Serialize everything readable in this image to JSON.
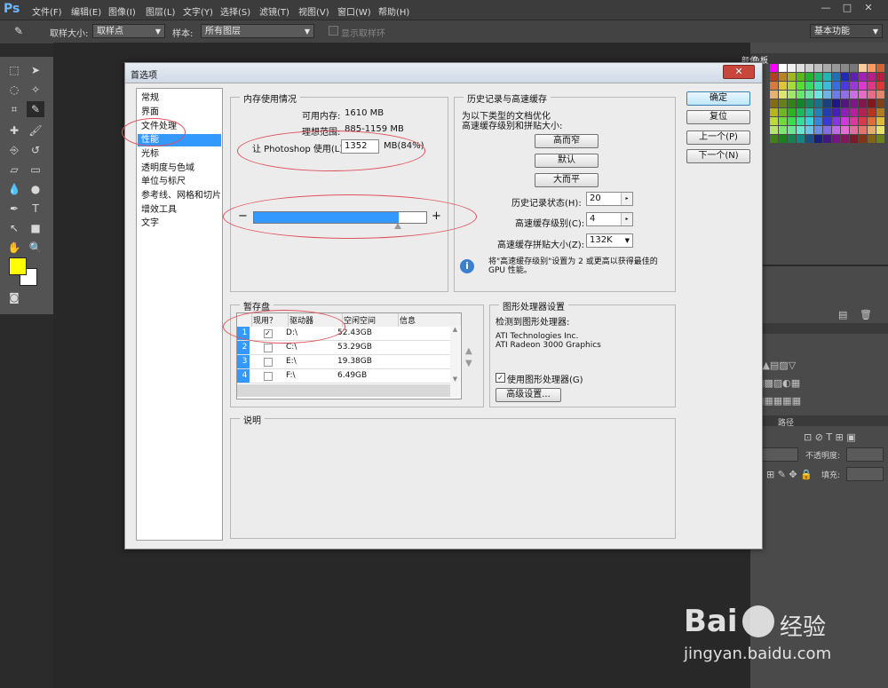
{
  "app": {
    "logo": "Ps",
    "menu": [
      "文件(F)",
      "编辑(E)",
      "图像(I)",
      "图层(L)",
      "文字(Y)",
      "选择(S)",
      "滤镜(T)",
      "视图(V)",
      "窗口(W)",
      "帮助(H)"
    ],
    "window_controls": [
      "—",
      "□",
      "✕"
    ]
  },
  "options": {
    "sample_size_label": "取样大小:",
    "sample_size_value": "取样点",
    "sample_label": "样本:",
    "sample_value": "所有图层",
    "show_ring_label": "显示取样环",
    "workspace_value": "基本功能"
  },
  "panels": {
    "tab_swatches_inactive": "颜色",
    "tab_swatches": "色板",
    "layers_tab_b": "路径",
    "opacity_label": "不透明度:",
    "fill_label": "填充:"
  },
  "dialog": {
    "title": "首选项",
    "close": "✕",
    "categories": [
      "常规",
      "界面",
      "文件处理",
      "性能",
      "光标",
      "透明度与色域",
      "单位与标尺",
      "参考线、网格和切片",
      "增效工具",
      "文字"
    ],
    "selected_category_index": 3,
    "buttons": {
      "ok": "确定",
      "reset": "复位",
      "prev": "上一个(P)",
      "next": "下一个(N)"
    },
    "memory": {
      "title": "内存使用情况",
      "available_label": "可用内存:",
      "available_value": "1610 MB",
      "ideal_label": "理想范围:",
      "ideal_value": "885-1159 MB",
      "use_label": "让 Photoshop 使用(L):",
      "use_value": "1352",
      "use_unit": "MB(84%)",
      "slider_fraction": 0.84,
      "minus": "−",
      "plus": "+"
    },
    "history": {
      "title": "历史记录与高速缓存",
      "desc1": "为以下类型的文档优化",
      "desc2": "高速缓存级别和拼贴大小:",
      "btn_tall_thin": "高而窄",
      "btn_default": "默认",
      "btn_big_flat": "大而平",
      "history_states_label": "历史记录状态(H):",
      "history_states_value": "20",
      "cache_levels_label": "高速缓存级别(C):",
      "cache_levels_value": "4",
      "tile_size_label": "高速缓存拼贴大小(Z):",
      "tile_size_value": "132K",
      "info_text1": "将\"高速缓存级别\"设置为 2 或更高以获得最佳的",
      "info_text2": "GPU 性能。"
    },
    "scratch": {
      "title": "暂存盘",
      "headers": [
        "现用？",
        "驱动器",
        "空闲空间",
        "信息"
      ],
      "rows": [
        {
          "n": "1",
          "active": true,
          "drive": "D:\\",
          "free": "52.43GB",
          "info": ""
        },
        {
          "n": "2",
          "active": false,
          "drive": "C:\\",
          "free": "53.29GB",
          "info": ""
        },
        {
          "n": "3",
          "active": false,
          "drive": "E:\\",
          "free": "19.38GB",
          "info": ""
        },
        {
          "n": "4",
          "active": false,
          "drive": "F:\\",
          "free": "6.49GB",
          "info": ""
        }
      ],
      "check": "✓"
    },
    "gpu": {
      "title": "图形处理器设置",
      "detected_label": "检测到图形处理器:",
      "vendor": "ATI Technologies Inc.",
      "model": "ATI Radeon 3000 Graphics",
      "use_gpu_label": "使用图形处理器(G)",
      "use_gpu_checked": true,
      "advanced_button": "高级设置..."
    },
    "description": {
      "title": "说明"
    }
  },
  "watermark": {
    "brand": "Bai",
    "brand2": "经验",
    "url": "jingyan.baidu.com"
  },
  "colors": {
    "accent": "#3399ff",
    "annotation": "#e0505a",
    "fg_color": "#ffff00",
    "bg_color": "#ffffff"
  }
}
